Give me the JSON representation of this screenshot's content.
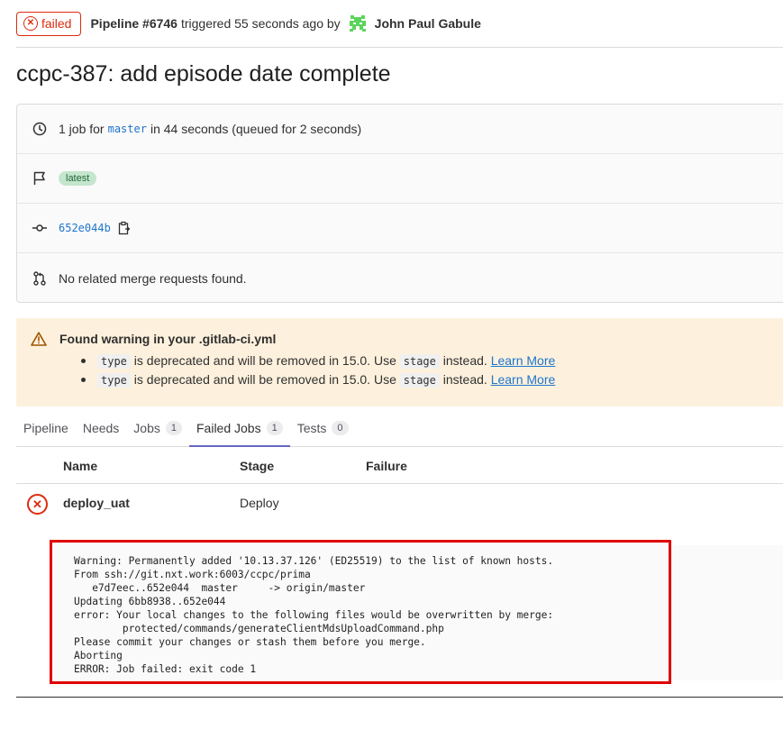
{
  "header": {
    "status_label": "failed",
    "pipeline_label": "Pipeline #6746",
    "triggered_text": "triggered 55 seconds ago by",
    "author": "John Paul Gabule"
  },
  "title": "ccpc-387: add episode date complete",
  "info": {
    "jobs_prefix": "1 job for",
    "branch": "master",
    "jobs_suffix": "in 44 seconds (queued for 2 seconds)",
    "tag": "latest",
    "commit": "652e044b",
    "merge_requests": "No related merge requests found."
  },
  "warning": {
    "title": "Found warning in your .gitlab-ci.yml",
    "items": [
      {
        "code1": "type",
        "text1": "is deprecated and will be removed in 15.0. Use",
        "code2": "stage",
        "text2": "instead.",
        "link": "Learn More"
      },
      {
        "code1": "type",
        "text1": "is deprecated and will be removed in 15.0. Use",
        "code2": "stage",
        "text2": "instead.",
        "link": "Learn More"
      }
    ]
  },
  "tabs": [
    {
      "label": "Pipeline"
    },
    {
      "label": "Needs"
    },
    {
      "label": "Jobs",
      "count": "1"
    },
    {
      "label": "Failed Jobs",
      "count": "1"
    },
    {
      "label": "Tests",
      "count": "0"
    }
  ],
  "table": {
    "headers": {
      "name": "Name",
      "stage": "Stage",
      "failure": "Failure"
    },
    "rows": [
      {
        "name": "deploy_uat",
        "stage": "Deploy",
        "failure": ""
      }
    ]
  },
  "log": [
    "Warning: Permanently added '10.13.37.126' (ED25519) to the list of known hosts.",
    "From ssh://git.nxt.work:6003/ccpc/prima",
    "   e7d7eec..652e044  master     -> origin/master",
    "Updating 6bb8938..652e044",
    "error: Your local changes to the following files would be overwritten by merge:",
    "        protected/commands/generateClientMdsUploadCommand.php",
    "Please commit your changes or stash them before you merge.",
    "Aborting",
    "ERROR: Job failed: exit code 1"
  ],
  "colors": {
    "failed": "#dd2b0e",
    "link": "#1f75cb",
    "warning_bg": "#fdf1dd",
    "highlight_box": "#e00000",
    "tab_active": "#6666c4"
  }
}
